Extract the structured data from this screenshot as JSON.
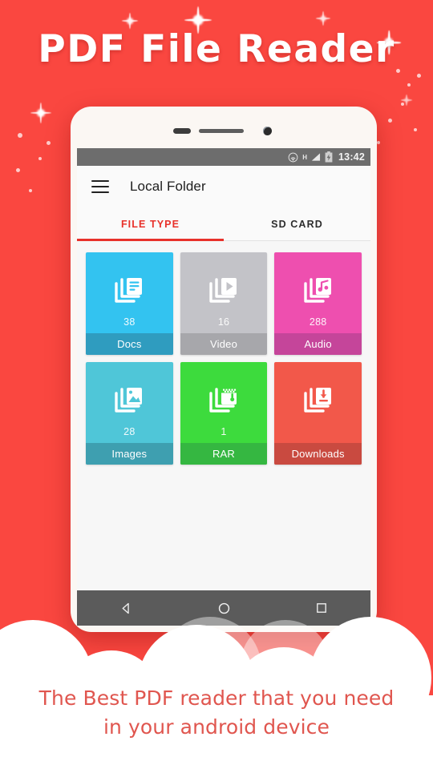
{
  "promo": {
    "headline": "PDF File Reader",
    "tagline_line1": "The Best PDF reader that you need",
    "tagline_line2": "in your android device",
    "background_color": "#fa4740",
    "headline_color": "#ffffff",
    "tagline_color": "#e0564f"
  },
  "statusbar": {
    "wifi_icon": "wifi-icon",
    "signal_label": "H",
    "signal_icon": "signal-bars-icon",
    "battery_icon": "battery-icon",
    "clock": "13:42",
    "background_color": "#6d6d6d"
  },
  "appbar": {
    "menu_icon": "hamburger-menu-icon",
    "title": "Local Folder"
  },
  "tabs": {
    "active_index": 0,
    "accent_color": "#e8312a",
    "items": [
      {
        "label": "FILE TYPE"
      },
      {
        "label": "SD CARD"
      }
    ]
  },
  "grid": {
    "tiles": [
      {
        "label": "Docs",
        "count": "38",
        "icon": "documents-stack-icon",
        "color": "#33c3f0",
        "footer_color": "#2f9cbf"
      },
      {
        "label": "Video",
        "count": "16",
        "icon": "video-play-stack-icon",
        "color": "#c3c3c8",
        "footer_color": "#a7a7ab"
      },
      {
        "label": "Audio",
        "count": "288",
        "icon": "music-note-stack-icon",
        "color": "#ee4faf",
        "footer_color": "#c5459a"
      },
      {
        "label": "Images",
        "count": "28",
        "icon": "photo-stack-icon",
        "color": "#4fc6d8",
        "footer_color": "#3e9fb0"
      },
      {
        "label": "RAR",
        "count": "1",
        "icon": "archive-zip-icon",
        "color": "#3ddb3d",
        "footer_color": "#35b741"
      },
      {
        "label": "Downloads",
        "count": "",
        "icon": "download-stack-icon",
        "color": "#f2584a",
        "footer_color": "#c94a40"
      }
    ]
  },
  "navbar": {
    "back_icon": "back-triangle-icon",
    "home_icon": "home-circle-icon",
    "recents_icon": "recents-square-icon",
    "background_color": "#5b5b5b"
  }
}
